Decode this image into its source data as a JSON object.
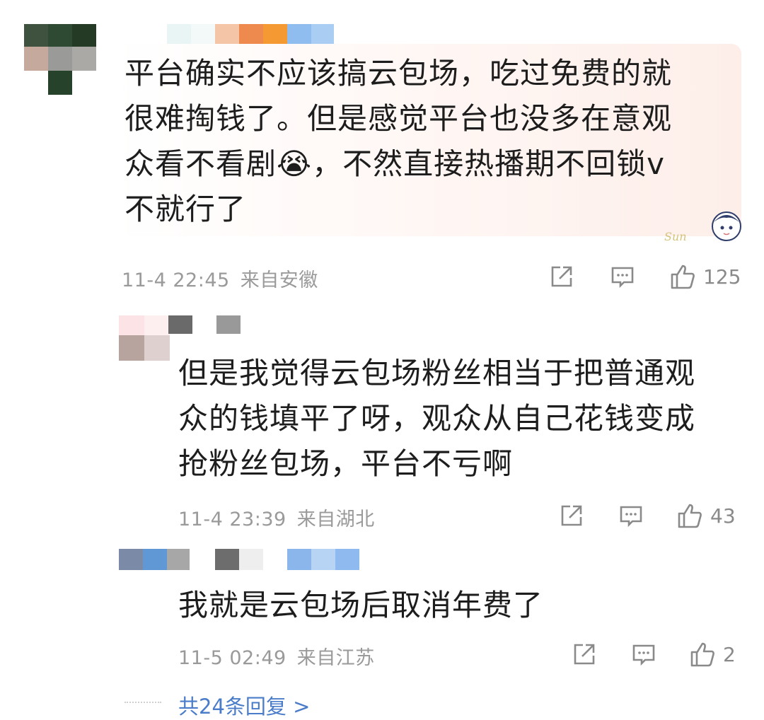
{
  "comments": [
    {
      "text": "平台确实不应该搞云包场，吃过免费的就\n很难掏钱了。但是感觉平台也没多在意观\n众看不看剧😭，不然直接热播期不回锁v\n不就行了",
      "time": "11-4 22:45",
      "location": "来自安徽",
      "likes": "125"
    },
    {
      "text": "但是我觉得云包场粉丝相当于把普通观\n众的钱填平了呀，观众从自己花钱变成\n抢粉丝包场，平台不亏啊",
      "time": "11-4 23:39",
      "location": "来自湖北",
      "likes": "43"
    },
    {
      "text": "我就是云包场后取消年费了",
      "time": "11-5 02:49",
      "location": "来自江苏",
      "likes": "2"
    }
  ],
  "footer": {
    "more_replies": "共24条回复 >"
  },
  "icons": {
    "share": "share-icon",
    "comment": "comment-icon",
    "like": "thumbs-up-icon"
  },
  "colors": {
    "link": "#4a7cc9",
    "meta": "#9a9a9a",
    "bubble": "#fdeee9"
  }
}
